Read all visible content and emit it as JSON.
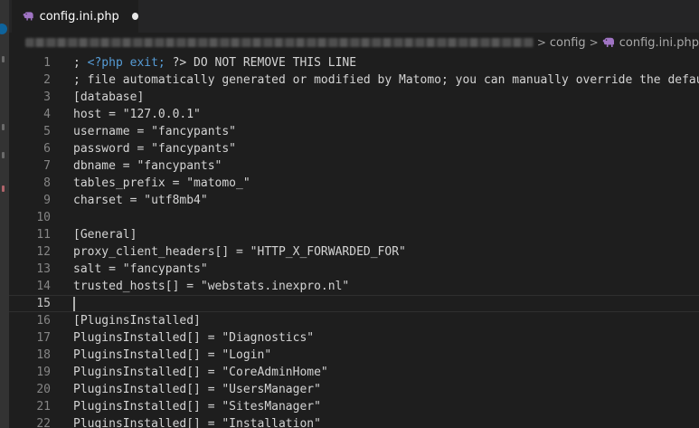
{
  "tab": {
    "label": "config.ini.php",
    "icon": "php-elephant-icon",
    "icon_color": "#a074c4",
    "unsaved": true
  },
  "breadcrumb": {
    "folder": "config",
    "separator": ">",
    "file": "config.ini.php"
  },
  "editor": {
    "current_line": 15,
    "lines": [
      {
        "n": "1",
        "text": "; ?> DO NOT REMOVE THIS LINE",
        "tag": "<?php exit;"
      },
      {
        "n": "2",
        "text": "; file automatically generated or modified by Matomo; you can manually override the default"
      },
      {
        "n": "3",
        "text": "[database]"
      },
      {
        "n": "4",
        "text": "host = \"127.0.0.1\""
      },
      {
        "n": "5",
        "text": "username = \"fancypants\""
      },
      {
        "n": "6",
        "text": "password = \"fancypants\""
      },
      {
        "n": "7",
        "text": "dbname = \"fancypants\""
      },
      {
        "n": "8",
        "text": "tables_prefix = \"matomo_\""
      },
      {
        "n": "9",
        "text": "charset = \"utf8mb4\""
      },
      {
        "n": "10",
        "text": ""
      },
      {
        "n": "11",
        "text": "[General]"
      },
      {
        "n": "12",
        "text": "proxy_client_headers[] = \"HTTP_X_FORWARDED_FOR\""
      },
      {
        "n": "13",
        "text": "salt = \"fancypants\""
      },
      {
        "n": "14",
        "text": "trusted_hosts[] = \"webstats.inexpro.nl\""
      },
      {
        "n": "15",
        "text": ""
      },
      {
        "n": "16",
        "text": "[PluginsInstalled]"
      },
      {
        "n": "17",
        "text": "PluginsInstalled[] = \"Diagnostics\""
      },
      {
        "n": "18",
        "text": "PluginsInstalled[] = \"Login\""
      },
      {
        "n": "19",
        "text": "PluginsInstalled[] = \"CoreAdminHome\""
      },
      {
        "n": "20",
        "text": "PluginsInstalled[] = \"UsersManager\""
      },
      {
        "n": "21",
        "text": "PluginsInstalled[] = \"SitesManager\""
      },
      {
        "n": "22",
        "text": "PluginsInstalled[] = \"Installation\""
      }
    ]
  },
  "colors": {
    "background": "#1e1e1e",
    "text": "#d4d4d4",
    "line_number": "#858585",
    "php_tag": "#569cd6",
    "activity_badge": "#0e639c"
  }
}
